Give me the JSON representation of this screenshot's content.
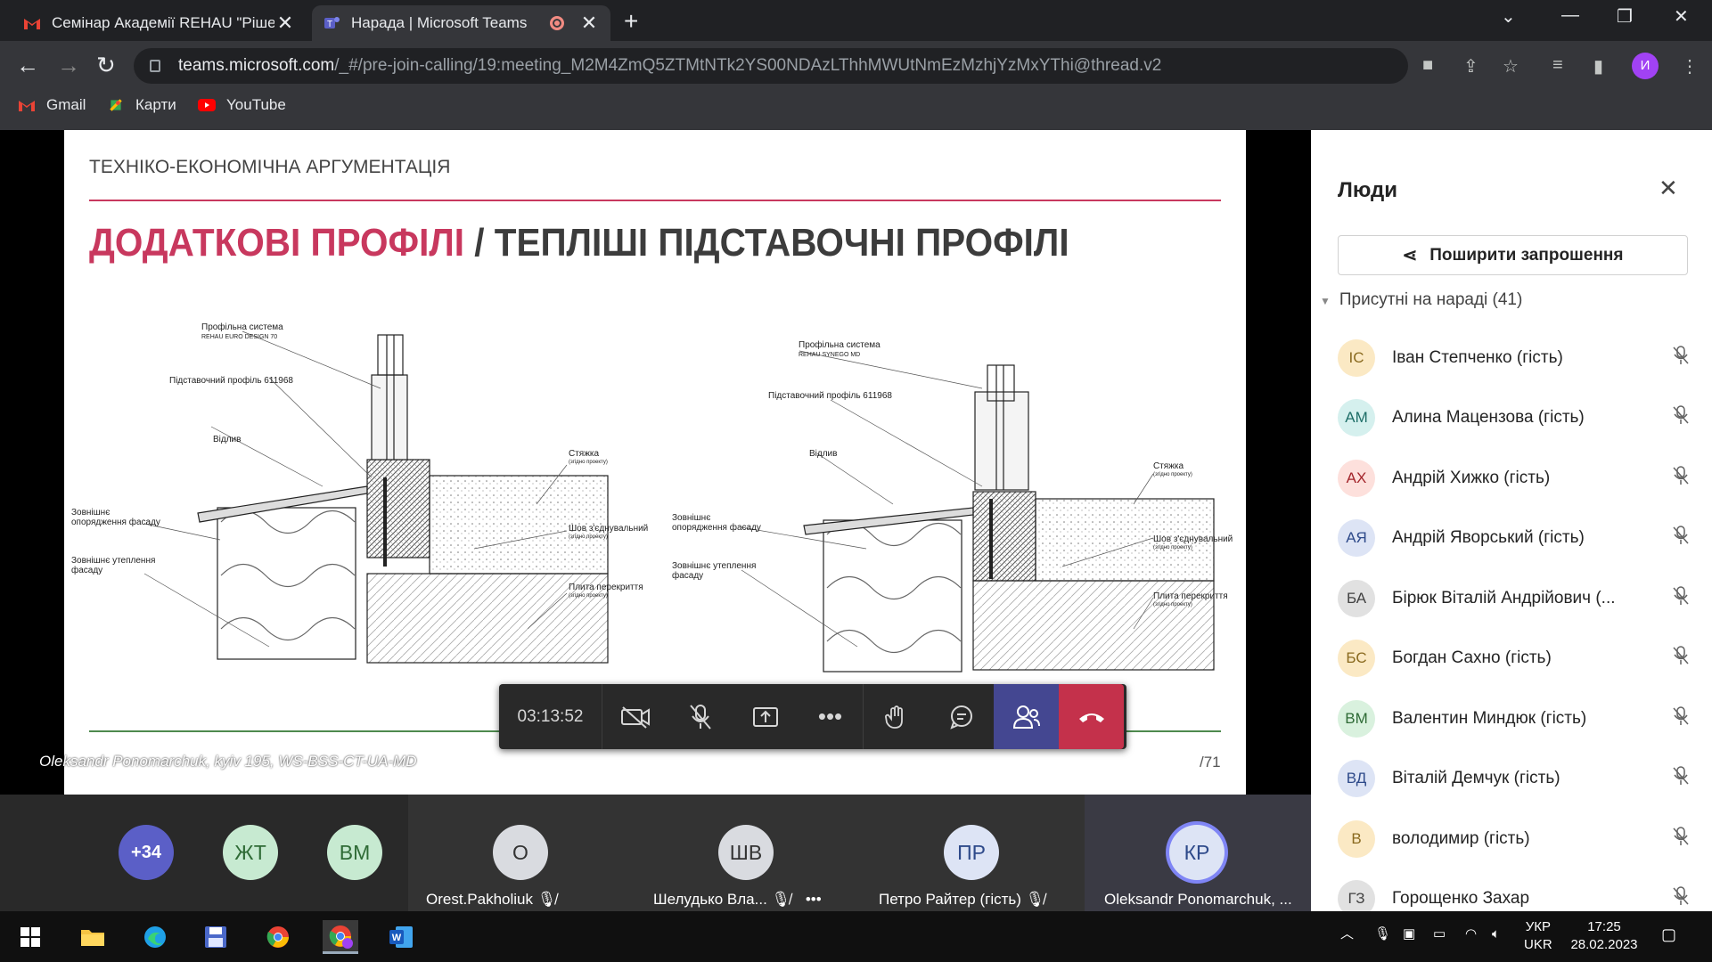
{
  "browser": {
    "tabs": [
      {
        "title": "Семінар Академії REHAU \"Рішен",
        "favicon": "gmail-icon"
      },
      {
        "title": "Нарада | Microsoft Teams",
        "favicon": "teams-icon"
      }
    ],
    "url_host": "teams.microsoft.com",
    "url_path": "/_#/pre-join-calling/19:meeting_M2M4ZmQ5ZTMtNTk2YS00NDAzLThhMWUtNmEzMzhjYzMxYThi@thread.v2",
    "bookmarks": [
      "Gmail",
      "Карти",
      "YouTube"
    ],
    "profile_initial": "И"
  },
  "slide": {
    "header": "ТЕХНІКО-ЕКОНОМІЧНА АРГУМЕНТАЦІЯ",
    "title_pink": "ДОДАТКОВІ ПРОФІЛІ",
    "title_rest": " / ТЕПЛІШІ ПІДСТАВОЧНІ ПРОФІЛІ",
    "page": "/71",
    "left_labels": {
      "profile_system": "Профільна система",
      "profile_sub": "REHAU EURO DESIGN 70",
      "base_profile": "Підставочний профіль 611968",
      "sill": "Відлив",
      "facade_finish": "Зовнішнє опорядження фасаду",
      "facade_insulation": "Зовнішнє утеплення фасаду",
      "screed": "Стяжка",
      "seam": "Шов з'єднувальний",
      "slab": "Плита перекриття",
      "note": "(згідно проекту)"
    },
    "right_labels": {
      "profile_system": "Профільна система",
      "profile_sub": "REHAU SYNEGO MD",
      "base_profile": "Підставочний профіль 611968",
      "sill": "Відлив",
      "facade_finish": "Зовнішнє опорядження фасаду",
      "facade_insulation": "Зовнішнє утеплення фасаду",
      "screed": "Стяжка",
      "seam": "Шов з'єднувальний",
      "slab": "Плита перекриття",
      "note": "(згідно проекту)"
    }
  },
  "presenter_label": "Oleksandr Ponomarchuk, kyiv 195, WS-BSS-CT-UA-MD",
  "controls": {
    "timer": "03:13:52"
  },
  "people_panel": {
    "title": "Люди",
    "share_label": "Поширити запрошення",
    "section": "Присутні на нараді (41)",
    "people": [
      {
        "initials": "ІС",
        "name": "Іван Степченко (гість)",
        "bg": "#fbe9c4",
        "fg": "#8a6a1f"
      },
      {
        "initials": "АМ",
        "name": "Алина Мацензова (гість)",
        "bg": "#d5f0ee",
        "fg": "#1f6e68"
      },
      {
        "initials": "АХ",
        "name": "Андрій Хижко (гість)",
        "bg": "#fde0dc",
        "fg": "#a4262c"
      },
      {
        "initials": "АЯ",
        "name": "Андрій Яворський (гість)",
        "bg": "#dde4f5",
        "fg": "#2e4a8a"
      },
      {
        "initials": "БА",
        "name": "Бірюк Віталій Андрійович (...",
        "bg": "#e1e1e1",
        "fg": "#424242"
      },
      {
        "initials": "БС",
        "name": "Богдан Сахно (гість)",
        "bg": "#fbe9c4",
        "fg": "#8a6a1f"
      },
      {
        "initials": "ВМ",
        "name": "Валентин Миндюк (гість)",
        "bg": "#d9f1de",
        "fg": "#2f6b36"
      },
      {
        "initials": "ВД",
        "name": "Віталій Демчук (гість)",
        "bg": "#dde4f5",
        "fg": "#2e4a8a"
      },
      {
        "initials": "В",
        "name": "володимир (гість)",
        "bg": "#fbe9c4",
        "fg": "#8a6a1f"
      },
      {
        "initials": "ГЗ",
        "name": "Горощенко Захар",
        "bg": "#e1e1e1",
        "fg": "#424242"
      }
    ]
  },
  "strip": {
    "overflow": "+34",
    "small_avatars": [
      {
        "initials": "ЖТ",
        "bg": "#c7ead1",
        "fg": "#2f6b36"
      },
      {
        "initials": "ВМ",
        "bg": "#c7ead1",
        "fg": "#2f6b36"
      }
    ],
    "tiles": [
      {
        "initials": "О",
        "name": "Orest.Pakholiuk"
      },
      {
        "initials": "ШВ",
        "name": "Шелудько Вла..."
      },
      {
        "initials": "ПР",
        "name": "Петро Райтер (гість)"
      },
      {
        "initials": "КР",
        "name": "Oleksandr Ponomarchuk, ..."
      }
    ]
  },
  "taskbar": {
    "lang_top": "УКР",
    "lang_bottom": "UKR",
    "time": "17:25",
    "date": "28.02.2023"
  },
  "colors": {
    "accent_pink": "#c8385e",
    "teams_purple": "#444791",
    "hangup_red": "#c4314b"
  }
}
